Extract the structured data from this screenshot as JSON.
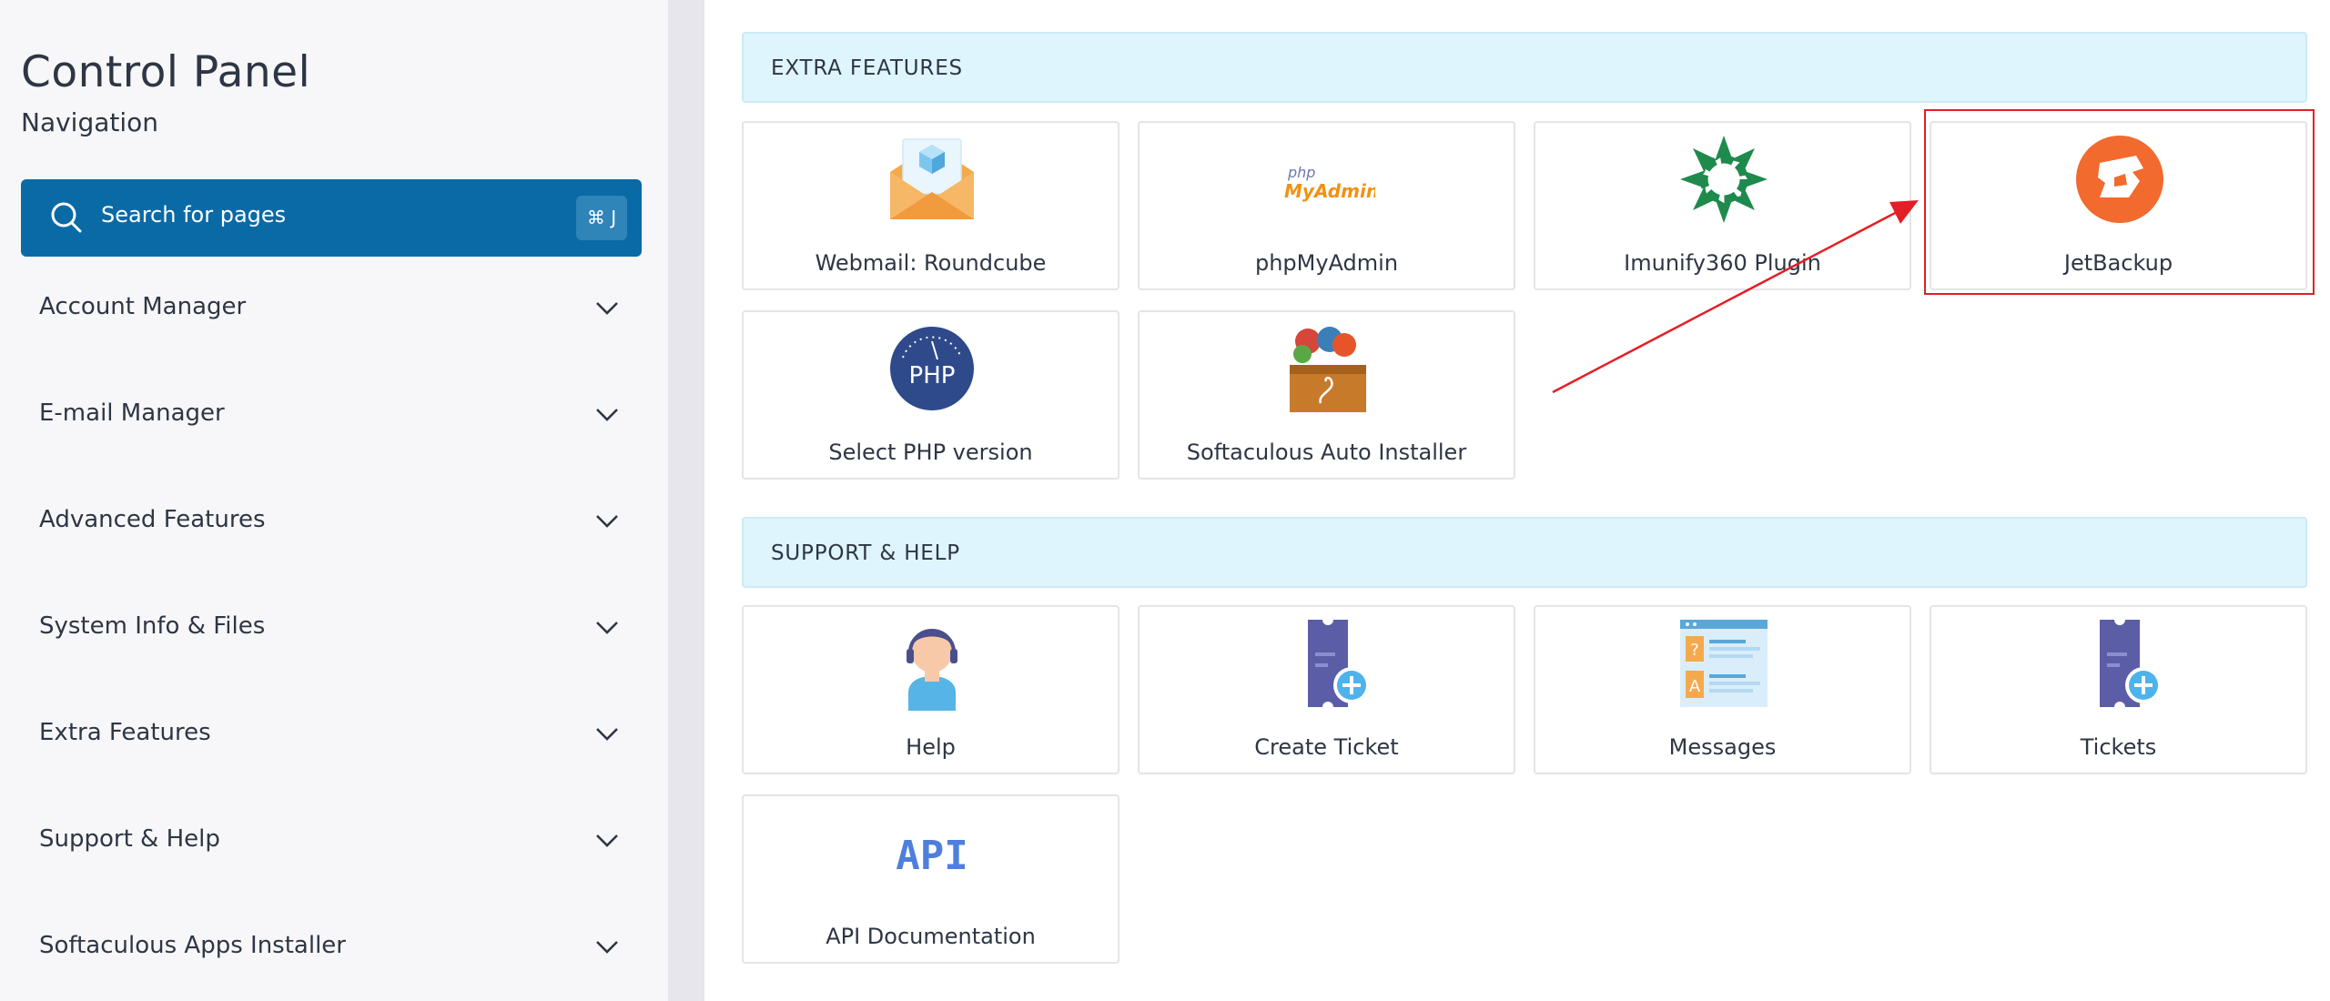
{
  "sidebar": {
    "title": "Control Panel",
    "subtitle": "Navigation",
    "search": {
      "placeholder": "Search for pages",
      "shortcut": "⌘ J"
    },
    "items": [
      {
        "label": "Account Manager"
      },
      {
        "label": "E-mail Manager"
      },
      {
        "label": "Advanced Features"
      },
      {
        "label": "System Info & Files"
      },
      {
        "label": "Extra Features"
      },
      {
        "label": "Support & Help"
      },
      {
        "label": "Softaculous Apps Installer"
      }
    ]
  },
  "sections": {
    "extra": {
      "heading": "EXTRA FEATURES",
      "cards": [
        {
          "label": "Webmail: Roundcube",
          "icon": "envelope-icon"
        },
        {
          "label": "phpMyAdmin",
          "icon": "phpmyadmin-icon",
          "logo_text_top": "php",
          "logo_text_bottom": "MyAdmin"
        },
        {
          "label": "Imunify360 Plugin",
          "icon": "imunify360-icon"
        },
        {
          "label": "JetBackup",
          "icon": "jetbackup-icon"
        },
        {
          "label": "Select PHP version",
          "icon": "php-icon",
          "logo_text": "PHP"
        },
        {
          "label": "Softaculous Auto Installer",
          "icon": "softaculous-icon"
        }
      ]
    },
    "support": {
      "heading": "SUPPORT & HELP",
      "cards": [
        {
          "label": "Help",
          "icon": "support-agent-icon"
        },
        {
          "label": "Create Ticket",
          "icon": "ticket-add-icon"
        },
        {
          "label": "Messages",
          "icon": "messages-icon"
        },
        {
          "label": "Tickets",
          "icon": "ticket-add-icon"
        },
        {
          "label": "API Documentation",
          "icon": "api-icon",
          "logo_text": "API"
        }
      ]
    }
  },
  "colors": {
    "search_bg": "#0a6aa6",
    "section_bg": "#dff5fd",
    "annotation": "#e41e26",
    "jetbackup": "#f26a2e",
    "php": "#2f4a8a",
    "ticket": "#5b5ea6"
  }
}
